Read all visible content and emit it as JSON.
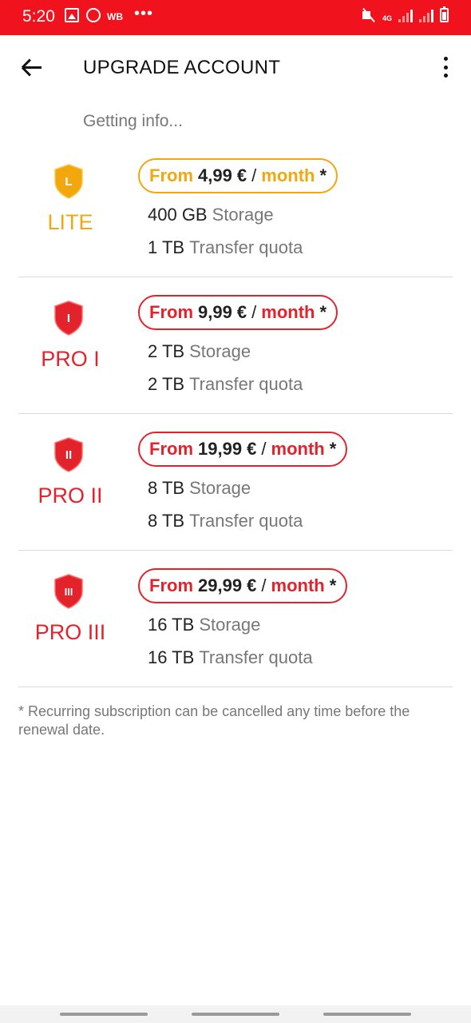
{
  "status_bar": {
    "time": "5:20",
    "carrier_tag": "WB",
    "more": "•••",
    "network": "4G",
    "background_color": "#f0121c",
    "icons": [
      "gallery-icon",
      "sync-icon",
      "mute-icon",
      "signal-icon",
      "battery-icon"
    ]
  },
  "toolbar": {
    "title": "UPGRADE ACCOUNT",
    "back_icon": "arrow-left-icon",
    "menu_icon": "more-vertical-icon"
  },
  "info_text": "Getting info...",
  "plans": [
    {
      "badge": "L",
      "name": "LITE",
      "color": "#f3a70f",
      "price_prefix": "From",
      "price": "4,99 €",
      "separator": "/",
      "period": "month",
      "asterisk": "*",
      "storage_amount": "400 GB",
      "storage_label": "Storage",
      "transfer_amount": "1 TB",
      "transfer_label": "Transfer quota"
    },
    {
      "badge": "I",
      "name": "PRO I",
      "color": "#e3232c",
      "price_prefix": "From",
      "price": "9,99 €",
      "separator": "/",
      "period": "month",
      "asterisk": "*",
      "storage_amount": "2 TB",
      "storage_label": "Storage",
      "transfer_amount": "2 TB",
      "transfer_label": "Transfer quota"
    },
    {
      "badge": "II",
      "name": "PRO II",
      "color": "#e3232c",
      "price_prefix": "From",
      "price": "19,99 €",
      "separator": "/",
      "period": "month",
      "asterisk": "*",
      "storage_amount": "8 TB",
      "storage_label": "Storage",
      "transfer_amount": "8 TB",
      "transfer_label": "Transfer quota"
    },
    {
      "badge": "III",
      "name": "PRO III",
      "color": "#e3232c",
      "price_prefix": "From",
      "price": "29,99 €",
      "separator": "/",
      "period": "month",
      "asterisk": "*",
      "storage_amount": "16 TB",
      "storage_label": "Storage",
      "transfer_amount": "16 TB",
      "transfer_label": "Transfer quota"
    }
  ],
  "footnote": "* Recurring subscription can be cancelled any time before the renewal date."
}
